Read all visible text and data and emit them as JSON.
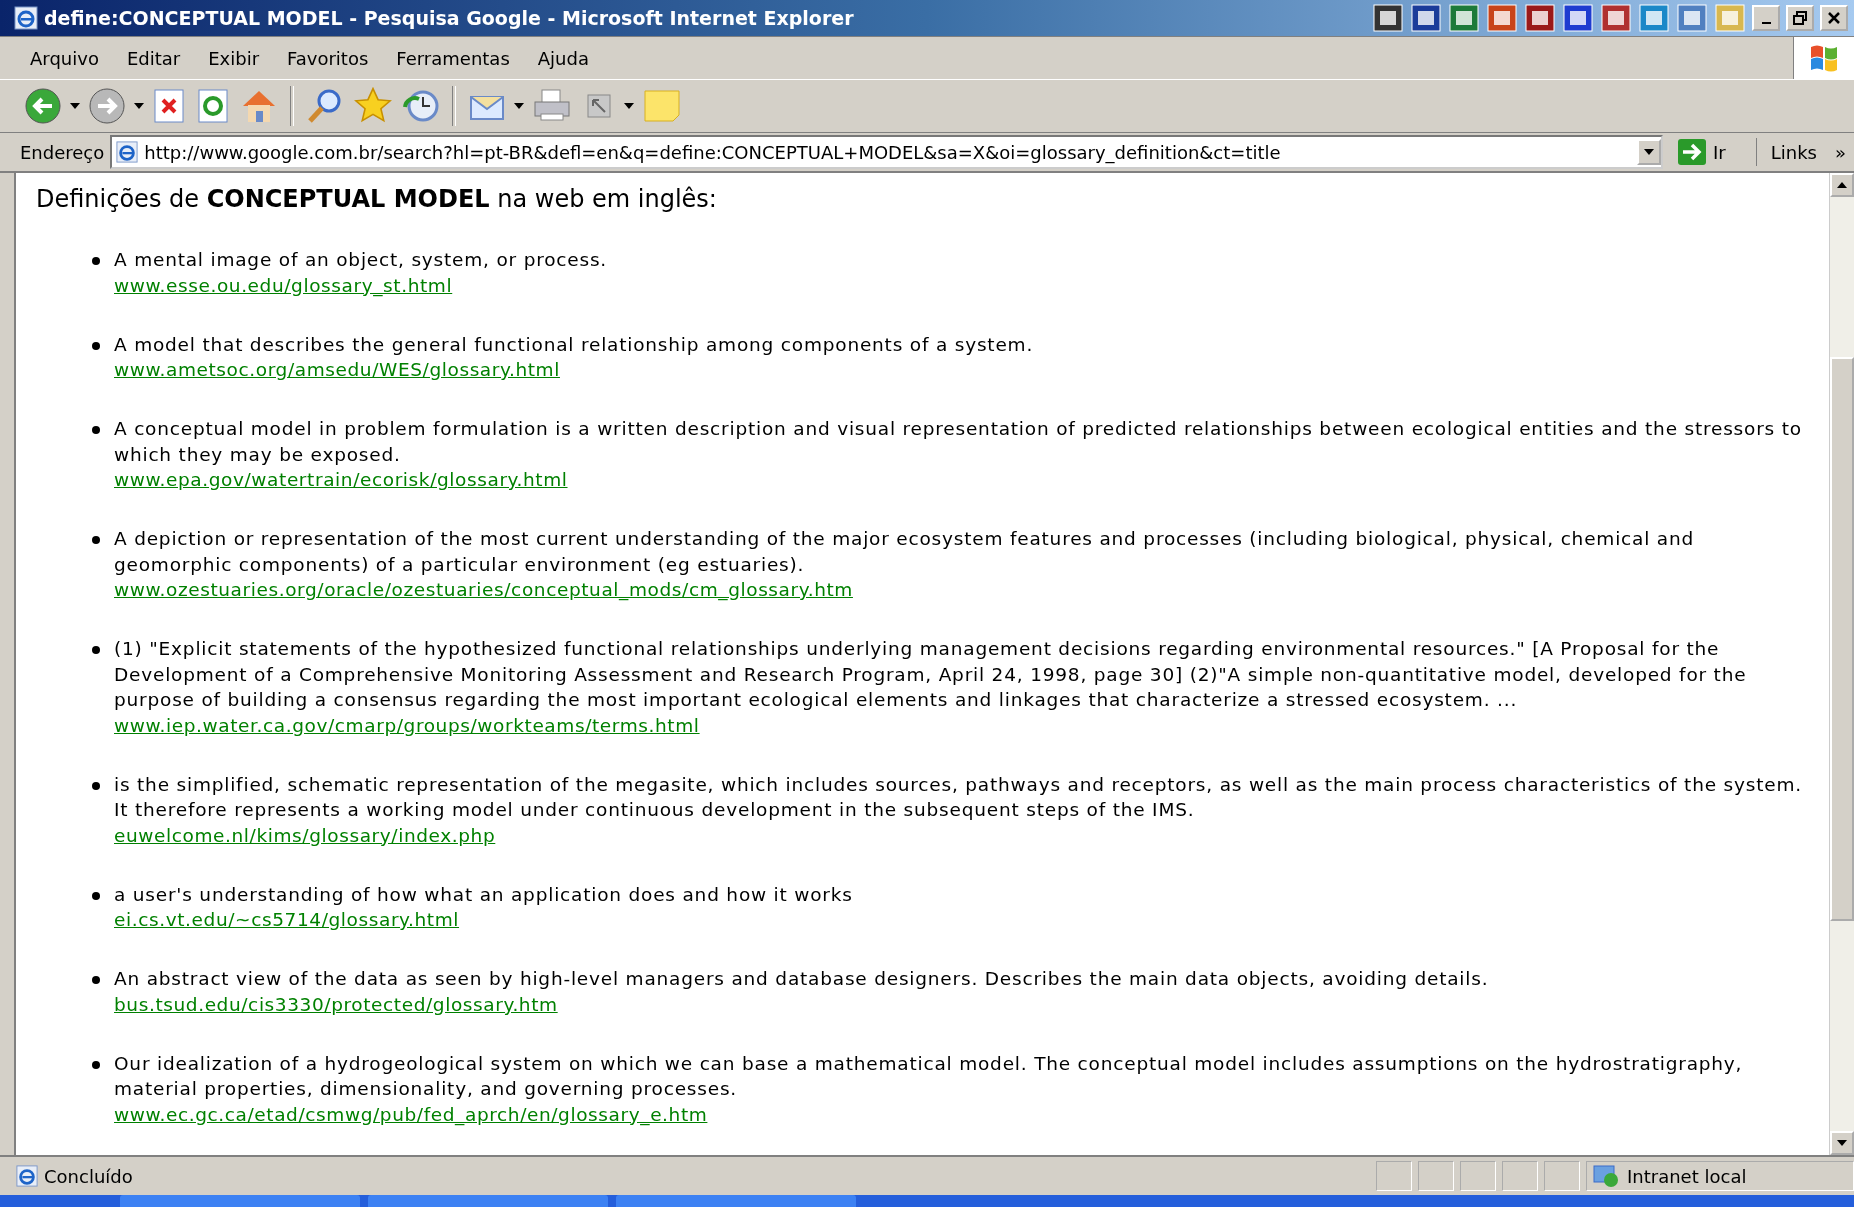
{
  "window": {
    "title": "define:CONCEPTUAL MODEL - Pesquisa Google - Microsoft Internet Explorer"
  },
  "menu": [
    "Arquivo",
    "Editar",
    "Exibir",
    "Favoritos",
    "Ferramentas",
    "Ajuda"
  ],
  "address_bar": {
    "label": "Endereço",
    "value": "http://www.google.com.br/search?hl=pt-BR&defl=en&q=define:CONCEPTUAL+MODEL&sa=X&oi=glossary_definition&ct=title",
    "go": "Ir",
    "links": "Links",
    "more": "»"
  },
  "heading": "Definições de **CONCEPTUAL MODEL** na web em inglês:",
  "definitions": [
    {
      "text": "A mental image of an object, system, or process.",
      "link": "www.esse.ou.edu/glossary_st.html"
    },
    {
      "text": "A model that describes the general functional relationship among components of a system.",
      "link": "www.ametsoc.org/amsedu/WES/glossary.html"
    },
    {
      "text": "A conceptual model in problem formulation is a written description and visual representation of predicted relationships between ecological entities and the stressors to which they may be exposed.",
      "link": "www.epa.gov/watertrain/ecorisk/glossary.html"
    },
    {
      "text": "A depiction or representation of the most current understanding of the major ecosystem features and processes (including biological, physical, chemical and geomorphic components) of a particular environment (eg estuaries).",
      "link": "www.ozestuaries.org/oracle/ozestuaries/conceptual_mods/cm_glossary.htm"
    },
    {
      "text": "(1) \"Explicit statements of the hypothesized functional relationships underlying management decisions regarding environmental resources.\" [A Proposal for the Development of a Comprehensive Monitoring Assessment and Research Program, April 24, 1998, page 30] (2)\"A simple non-quantitative model, developed for the purpose of building a consensus regarding the most important ecological elements and linkages that characterize a stressed ecosystem. ...",
      "link": "www.iep.water.ca.gov/cmarp/groups/workteams/terms.html"
    },
    {
      "text": "is the simplified, schematic representation of the megasite, which includes sources, pathways and receptors, as well as the main process characteristics of the system. It therefore represents a working model under continuous development in the subsequent steps of the IMS.",
      "link": "euwelcome.nl/kims/glossary/index.php"
    },
    {
      "text": "a user's understanding of how what an application does and how it works",
      "link": "ei.cs.vt.edu/~cs5714/glossary.html"
    },
    {
      "text": "An abstract view of the data as seen by high-level managers and database designers. Describes the main data objects, avoiding details.",
      "link": "bus.tsud.edu/cis3330/protected/glossary.htm"
    },
    {
      "text": "Our idealization of a hydrogeological system on which we can base a mathematical model. The conceptual model includes assumptions on the hydrostratigraphy, material properties, dimensionality, and governing processes.",
      "link": "www.ec.gc.ca/etad/csmwg/pub/fed_aprch/en/glossary_e.htm"
    }
  ],
  "status_bar": {
    "text": "Concluído",
    "zone": "Intranet local"
  }
}
